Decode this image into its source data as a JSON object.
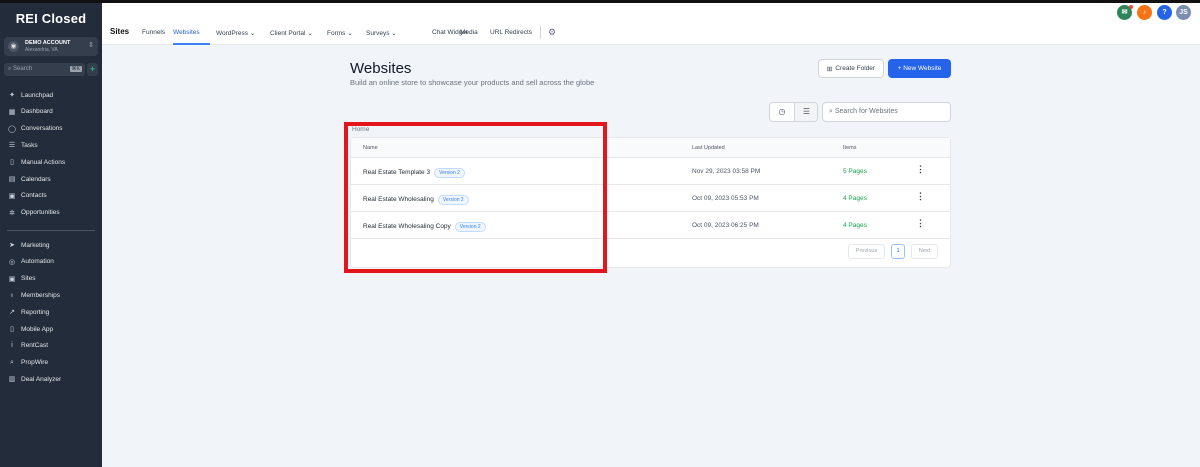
{
  "sidebar": {
    "logo": "REI Closed",
    "account": {
      "name": "DEMO ACCOUNT",
      "location": "Alexandria, VA"
    },
    "search": {
      "placeholder": "Search",
      "shortcut": "⌘K"
    },
    "items": [
      {
        "label": "Launchpad",
        "icon": "rocket-icon",
        "g": "✦"
      },
      {
        "label": "Dashboard",
        "icon": "dashboard-icon",
        "g": "▦"
      },
      {
        "label": "Conversations",
        "icon": "chat-icon",
        "g": "◯"
      },
      {
        "label": "Tasks",
        "icon": "tasks-icon",
        "g": "☰"
      },
      {
        "label": "Manual Actions",
        "icon": "phone-icon",
        "g": "▯"
      },
      {
        "label": "Calendars",
        "icon": "calendar-icon",
        "g": "▤"
      },
      {
        "label": "Contacts",
        "icon": "contacts-icon",
        "g": "▣"
      },
      {
        "label": "Opportunities",
        "icon": "opportunities-icon",
        "g": "✲"
      }
    ],
    "items2": [
      {
        "label": "Marketing",
        "icon": "send-icon",
        "g": "➤"
      },
      {
        "label": "Automation",
        "icon": "automation-icon",
        "g": "◎"
      },
      {
        "label": "Sites",
        "icon": "sites-icon",
        "g": "▣"
      },
      {
        "label": "Memberships",
        "icon": "award-icon",
        "g": "♁"
      },
      {
        "label": "Reporting",
        "icon": "chart-icon",
        "g": "↗"
      },
      {
        "label": "Mobile App",
        "icon": "mobile-icon",
        "g": "▯"
      },
      {
        "label": "RentCast",
        "icon": "info-icon",
        "g": "i"
      },
      {
        "label": "PropWire",
        "icon": "search-icon",
        "g": "⌕"
      },
      {
        "label": "Deal Analyzer",
        "icon": "calculator-icon",
        "g": "▥"
      }
    ]
  },
  "header": {
    "title": "Sites",
    "tabs": [
      "Funnels",
      "Websites",
      "WordPress",
      "Client Portal",
      "Forms",
      "Surveys",
      "Chat Widget",
      "Media",
      "URL Redirects"
    ],
    "avatar": "JS",
    "help": "?"
  },
  "page": {
    "title": "Websites",
    "subtitle": "Build an online store to showcase your products and sell across the globe",
    "create_folder": "Create Folder",
    "new_website": "+ New Website",
    "search_placeholder": "Search for Websites",
    "breadcrumb": "Home"
  },
  "table": {
    "columns": [
      "Name",
      "Last Updated",
      "Items"
    ],
    "rows": [
      {
        "name": "Real Estate Template 3",
        "badge": "Version 2",
        "updated": "Nov 29, 2023 03:58 PM",
        "items": "5 Pages"
      },
      {
        "name": "Real Estate Wholesaling",
        "badge": "Version 2",
        "updated": "Oct 09, 2023 05:53 PM",
        "items": "4 Pages"
      },
      {
        "name": "Real Estate Wholesaling Copy",
        "badge": "Version 2",
        "updated": "Oct 09, 2023 06:25 PM",
        "items": "4 Pages"
      }
    ]
  },
  "pagination": {
    "previous": "Previous",
    "current": "1",
    "next": "Next"
  },
  "colors": {
    "accent": "#2563eb",
    "highlight": "#e3161b",
    "sidebar": "#232c3a"
  }
}
